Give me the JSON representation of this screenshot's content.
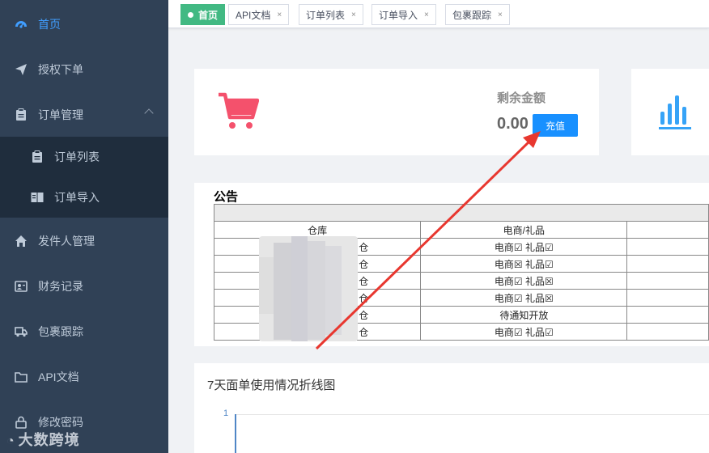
{
  "sidebar": {
    "items": [
      {
        "label": "首页",
        "icon": "dashboard-icon"
      },
      {
        "label": "授权下单",
        "icon": "send-icon"
      },
      {
        "label": "订单管理",
        "icon": "clipboard-icon"
      },
      {
        "label": "发件人管理",
        "icon": "home-icon"
      },
      {
        "label": "财务记录",
        "icon": "id-card-icon"
      },
      {
        "label": "包裹跟踪",
        "icon": "truck-icon"
      },
      {
        "label": "API文档",
        "icon": "folder-icon"
      },
      {
        "label": "修改密码",
        "icon": "lock-icon"
      }
    ],
    "subitems": [
      {
        "label": "订单列表",
        "icon": "clipboard-icon"
      },
      {
        "label": "订单导入",
        "icon": "import-icon"
      }
    ]
  },
  "tabs": [
    {
      "label": "首页",
      "active": true
    },
    {
      "label": "API文档",
      "close": "×"
    },
    {
      "label": "订单列表",
      "close": "×"
    },
    {
      "label": "订单导入",
      "close": "×"
    },
    {
      "label": "包裹跟踪",
      "close": "×"
    }
  ],
  "balance": {
    "label": "剩余金额",
    "value": "0.00",
    "recharge_label": "充值"
  },
  "notice": {
    "title": "公告",
    "headers": [
      "仓库",
      "电商/礼品"
    ],
    "rows": [
      {
        "warehouse": "仓",
        "type": "电商☑  礼品☑"
      },
      {
        "warehouse": "仓",
        "type": "电商☒  礼品☑"
      },
      {
        "warehouse": "仓",
        "type": "电商☑  礼品☒"
      },
      {
        "warehouse": "仓",
        "type": "电商☑  礼品☒"
      },
      {
        "warehouse": "仓",
        "type": "待通知开放"
      },
      {
        "warehouse": "仓",
        "type": "电商☑  礼品☑"
      }
    ]
  },
  "chart": {
    "title": "7天面单使用情况折线图",
    "y_tick": "1"
  },
  "watermark": "大数跨境",
  "colors": {
    "sidebar_bg": "#304156",
    "accent": "#409eff",
    "tab_active": "#42b983",
    "cart": "#f4516c",
    "stats": "#36a3f7",
    "arrow": "#e8372f"
  }
}
